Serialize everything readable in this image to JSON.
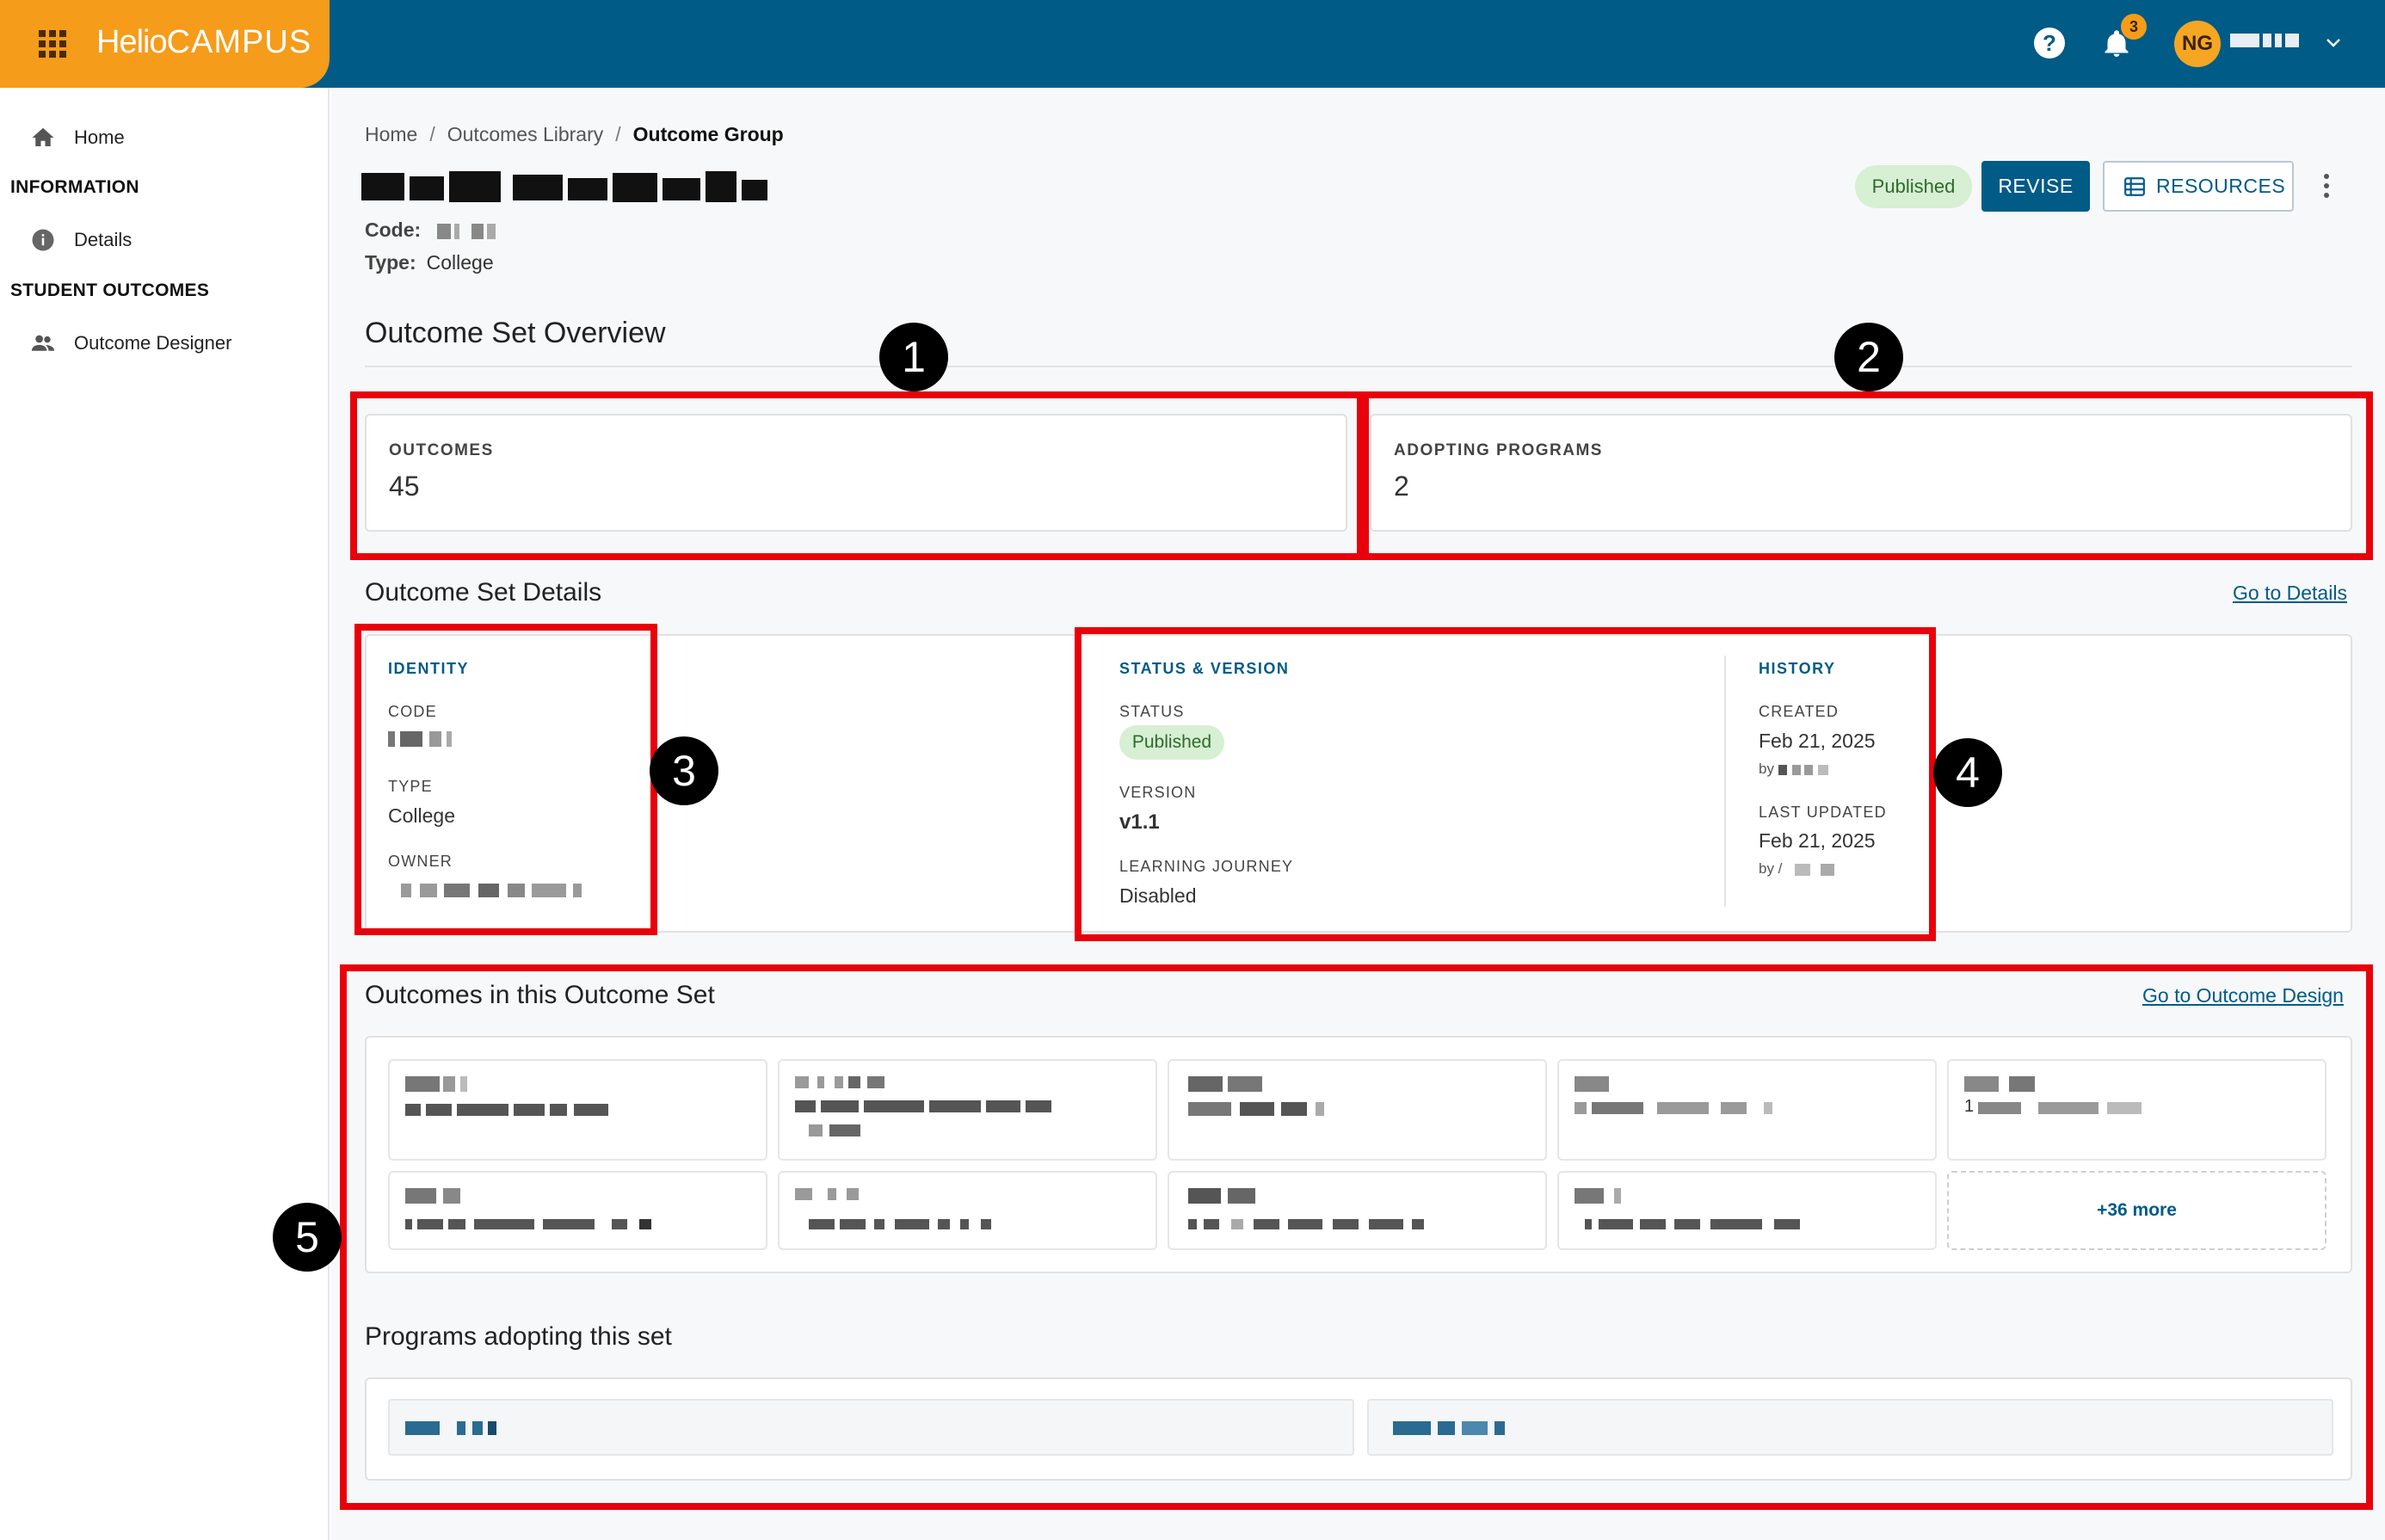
{
  "header": {
    "brand_part1": "Helio",
    "brand_part2": "CAMPUS",
    "notification_count": "3",
    "avatar_initials": "NG"
  },
  "sidebar": {
    "home": "Home",
    "section_information": "INFORMATION",
    "details": "Details",
    "section_student_outcomes": "STUDENT OUTCOMES",
    "outcome_designer": "Outcome Designer"
  },
  "breadcrumb": {
    "home": "Home",
    "library": "Outcomes Library",
    "current": "Outcome Group"
  },
  "page": {
    "code_label": "Code:",
    "type_label": "Type:",
    "type_value": "College",
    "status_pill": "Published",
    "revise_label": "REVISE",
    "resources_label": "RESOURCES"
  },
  "overview": {
    "title": "Outcome Set Overview",
    "outcomes_label": "OUTCOMES",
    "outcomes_value": "45",
    "programs_label": "ADOPTING PROGRAMS",
    "programs_value": "2"
  },
  "details": {
    "title": "Outcome Set Details",
    "go_link": "Go to Details",
    "identity_title": "IDENTITY",
    "code_label": "CODE",
    "type_label": "TYPE",
    "type_value": "College",
    "owner_label": "OWNER",
    "status_title": "STATUS & VERSION",
    "status_label": "STATUS",
    "status_value": "Published",
    "version_label": "VERSION",
    "version_value": "v1.1",
    "journey_label": "LEARNING JOURNEY",
    "journey_value": "Disabled",
    "history_title": "HISTORY",
    "created_label": "CREATED",
    "created_value": "Feb 21, 2025",
    "created_by": "by",
    "updated_label": "LAST UPDATED",
    "updated_value": "Feb 21, 2025",
    "updated_by": "by /"
  },
  "outcomes_section": {
    "title": "Outcomes in this Outcome Set",
    "go_link": "Go to Outcome Design",
    "more_label": "+36 more",
    "tile5_prefix": "1"
  },
  "programs_section": {
    "title": "Programs adopting this set"
  },
  "annotations": [
    "1",
    "2",
    "3",
    "4",
    "5"
  ],
  "colors": {
    "topbar": "#005b87",
    "brand": "#f59c1a",
    "annotation_box": "#e8000a",
    "published_pill": "#d7efd3"
  }
}
